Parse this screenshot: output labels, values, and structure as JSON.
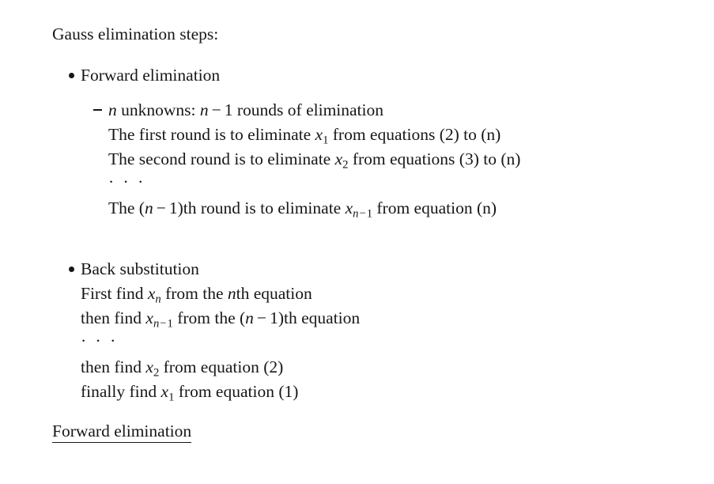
{
  "slide": {
    "intro": "Gauss elimination steps:",
    "sections": {
      "forward": {
        "bullet_label": "Forward elimination",
        "dash_item": {
          "prefix_var": "n",
          "text_mid": " unknowns: ",
          "expr_var": "n",
          "expr_op": "−",
          "expr_num": "1",
          "text_end": " rounds of elimination"
        },
        "lines": [
          {
            "pre": "The first round is to eliminate ",
            "var": "x",
            "sub": "1",
            "post": " from equations (2) to (n)"
          },
          {
            "pre": "The second round is to eliminate ",
            "var": "x",
            "sub": "2",
            "post": " from equations (3) to (n)"
          }
        ],
        "ellipsis": "· · ·",
        "last_line": {
          "pre": "The (",
          "paren_var": "n",
          "paren_op": "−",
          "paren_num": "1",
          "mid": ")th round is to eliminate ",
          "var": "x",
          "sub_var": "n",
          "sub_op": "−",
          "sub_num": "1",
          "post": " from equation (n)"
        }
      },
      "back": {
        "bullet_label": "Back substitution",
        "line1": {
          "pre": "First find ",
          "var": "x",
          "sub_var": "n",
          "mid": " from the ",
          "ord_var": "n",
          "post": "th equation"
        },
        "line2": {
          "pre": "then find ",
          "var": "x",
          "sub_var": "n",
          "sub_op": "−",
          "sub_num": "1",
          "mid": " from the (",
          "paren_var": "n",
          "paren_op": "−",
          "paren_num": "1",
          "post": ")th equation"
        },
        "ellipsis": "· · ·",
        "line3": {
          "pre": "then find ",
          "var": "x",
          "sub": "2",
          "post": " from equation (2)"
        },
        "line4": {
          "pre": "finally find ",
          "var": "x",
          "sub": "1",
          "post": " from equation (1)"
        }
      }
    },
    "section_heading": "Forward elimination"
  },
  "colors": {
    "text": "#171717",
    "background": "#ffffff"
  }
}
